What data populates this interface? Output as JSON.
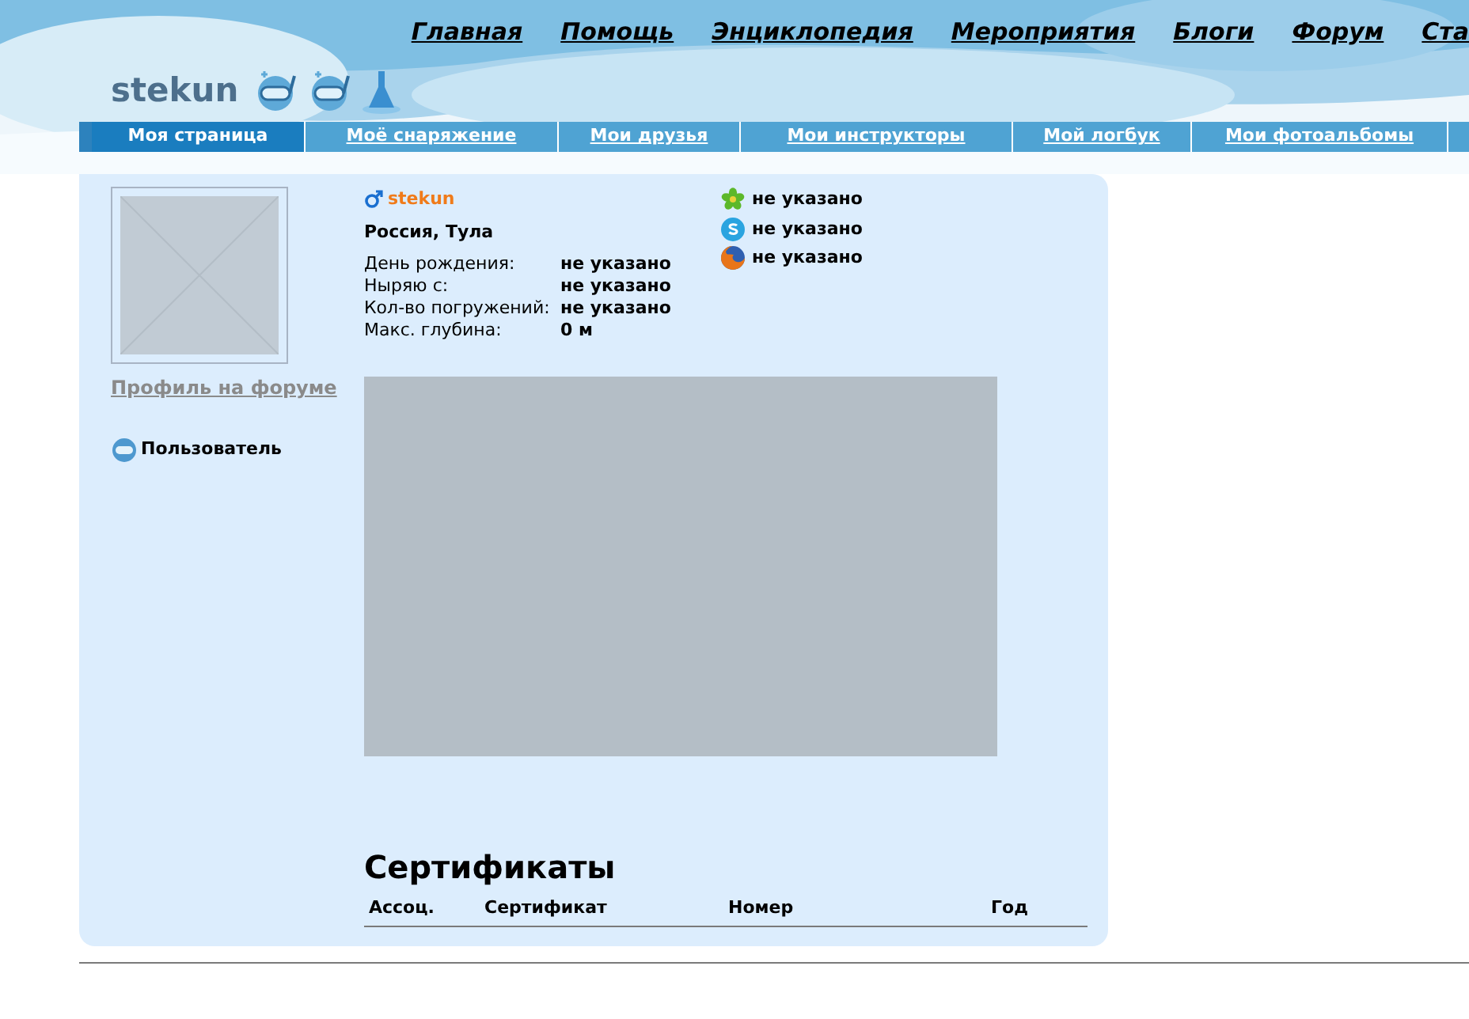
{
  "top_nav": [
    "Главная",
    "Помощь",
    "Энциклопедия",
    "Мероприятия",
    "Блоги",
    "Форум",
    "Ста"
  ],
  "username": "stekun",
  "tabs": [
    {
      "label": "Моя страница",
      "selected": true
    },
    {
      "label": "Моё снаряжение",
      "selected": false
    },
    {
      "label": "Мои друзья",
      "selected": false
    },
    {
      "label": "Мои инструкторы",
      "selected": false
    },
    {
      "label": "Мой логбук",
      "selected": false
    },
    {
      "label": "Мои фотоальбомы",
      "selected": false
    }
  ],
  "profile": {
    "forum_link": "Профиль на форуме",
    "role": "Пользователь",
    "name": "stekun",
    "location": "Россия, Тула",
    "fields": [
      {
        "label": "День рождения:",
        "value": "не указано"
      },
      {
        "label": "Ныряю с:",
        "value": "не указано"
      },
      {
        "label": "Кол-во погружений:",
        "value": "не указано"
      },
      {
        "label": "Макс. глубина:",
        "value": "0 м"
      }
    ],
    "contacts": [
      {
        "kind": "icq",
        "value": "не указано"
      },
      {
        "kind": "skype",
        "value": "не указано"
      },
      {
        "kind": "firefox",
        "value": "не указано"
      }
    ]
  },
  "certificates": {
    "title": "Сертификаты",
    "columns": [
      "Ассоц.",
      "Сертификат",
      "Номер",
      "Год"
    ]
  }
}
